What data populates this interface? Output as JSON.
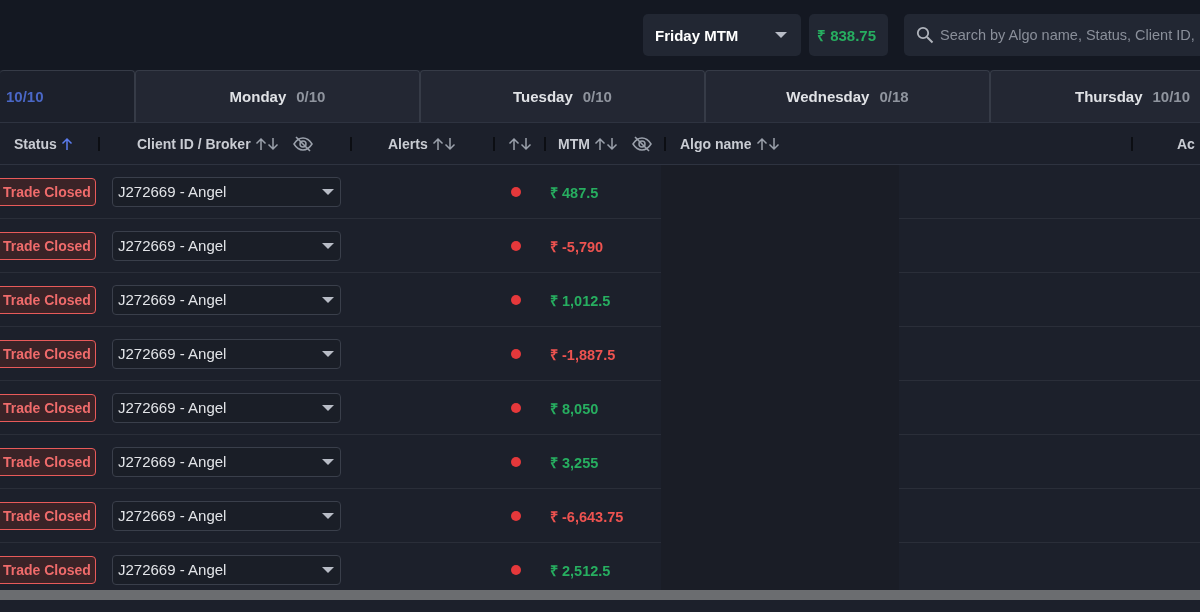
{
  "toolbar": {
    "mtm_select": {
      "value": "Friday MTM"
    },
    "total_mtm": {
      "value": "₹ 838.75",
      "kind": "profit"
    },
    "search": {
      "placeholder": "Search by Algo name, Status, Client ID,"
    }
  },
  "tabs": [
    {
      "count": "10/10",
      "selected": true
    },
    {
      "label": "Monday",
      "count": "0/10",
      "selected": false
    },
    {
      "label": "Tuesday",
      "count": "0/10",
      "selected": false
    },
    {
      "label": "Wednesday",
      "count": "0/18",
      "selected": false
    },
    {
      "label": "Thursday",
      "count": "10/10",
      "selected": false
    }
  ],
  "table": {
    "columns": [
      {
        "label": "Status",
        "sorted": true
      },
      {
        "label": "Client ID / Broker",
        "sorted": false,
        "hide_toggle": true
      },
      {
        "label": "Alerts",
        "sorted": false
      },
      {
        "sorted": false
      },
      {
        "label": "MTM",
        "sorted": false,
        "hide_toggle": true
      },
      {
        "label": "Algo name",
        "sorted": false
      },
      {
        "label": "Ac"
      }
    ],
    "rows": [
      {
        "status": "Trade Closed",
        "client": "J272669 - Angel",
        "color": "#e5383b",
        "mtm": "₹ 487.5",
        "kind": "profit"
      },
      {
        "status": "Trade Closed",
        "client": "J272669 - Angel",
        "color": "#e5383b",
        "mtm": "₹ -5,790",
        "kind": "loss"
      },
      {
        "status": "Trade Closed",
        "client": "J272669 - Angel",
        "color": "#e5383b",
        "mtm": "₹ 1,012.5",
        "kind": "profit"
      },
      {
        "status": "Trade Closed",
        "client": "J272669 - Angel",
        "color": "#e5383b",
        "mtm": "₹ -1,887.5",
        "kind": "loss"
      },
      {
        "status": "Trade Closed",
        "client": "J272669 - Angel",
        "color": "#e5383b",
        "mtm": "₹ 8,050",
        "kind": "profit"
      },
      {
        "status": "Trade Closed",
        "client": "J272669 - Angel",
        "color": "#e5383b",
        "mtm": "₹ 3,255",
        "kind": "profit"
      },
      {
        "status": "Trade Closed",
        "client": "J272669 - Angel",
        "color": "#e5383b",
        "mtm": "₹ -6,643.75",
        "kind": "loss"
      },
      {
        "status": "Trade Closed",
        "client": "J272669 - Angel",
        "color": "#e5383b",
        "mtm": "₹ 2,512.5",
        "kind": "profit"
      }
    ]
  }
}
